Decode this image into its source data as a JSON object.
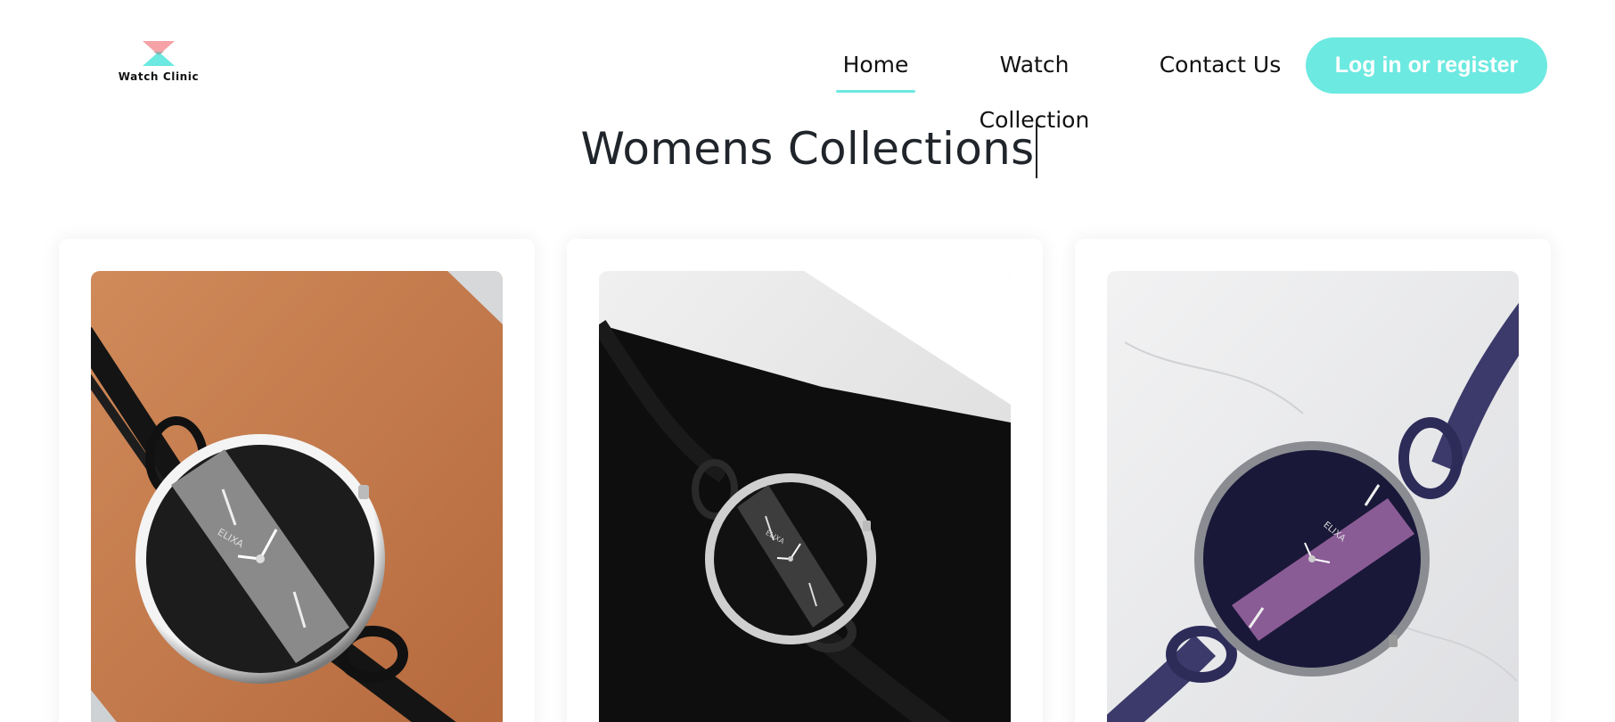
{
  "brand": {
    "name": "Watch Clinic",
    "logo_icon": "hourglass-logo-icon",
    "colors": {
      "pink": "#f5a3a6",
      "teal": "#6ce9e0"
    }
  },
  "nav": {
    "items": [
      {
        "label": "Home",
        "active": true
      },
      {
        "label": "Watch Collection",
        "active": false
      },
      {
        "label": "Contact Us",
        "active": false
      }
    ],
    "login_label": "Log in or register"
  },
  "page": {
    "title": "Womens Collections"
  },
  "products": [
    {
      "watch_brand": "ELIXA",
      "image": "black-watch-on-orange-background"
    },
    {
      "watch_brand": "ELIXA",
      "image": "black-watch-on-black-fabric"
    },
    {
      "watch_brand": "ELIXA",
      "image": "purple-watch-on-marble"
    }
  ],
  "accent": "#6ce9e0"
}
